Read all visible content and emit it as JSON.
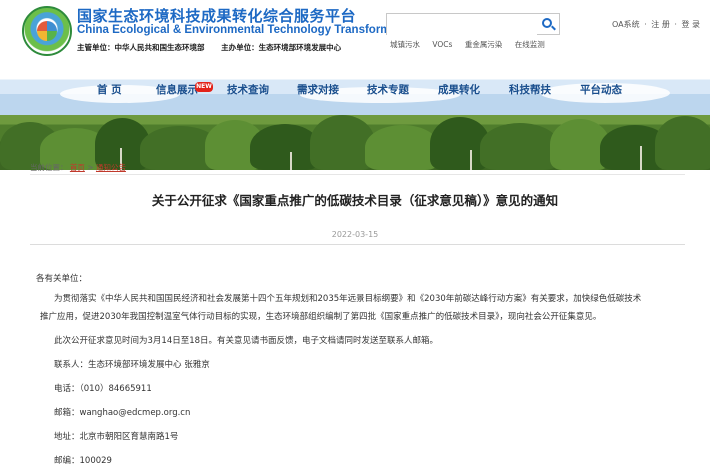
{
  "header": {
    "title_cn": "国家生态环境科技成果转化综合服务平台",
    "title_en": "China Ecological & Environmental Technology Transformation",
    "sponsor": "主管单位：中华人民共和国生态环境部",
    "organizer": "主办单位：生态环境部环境发展中心",
    "search_placeholder": "",
    "hot_tags": [
      "城镇污水",
      "VOCs",
      "重金属污染",
      "在线监测"
    ],
    "top_links": {
      "oa": "OA系统",
      "sep": "·",
      "register": "注 册",
      "sep2": "·",
      "login": "登 录"
    }
  },
  "nav": {
    "items": [
      "首  页",
      "信息展示",
      "技术查询",
      "需求对接",
      "技术专题",
      "成果转化",
      "科技帮扶",
      "平台动态"
    ],
    "badge": "NEW"
  },
  "breadcrumb": {
    "prefix": "当前位置：",
    "home": "首页",
    "sep": ">",
    "current": "通知公告"
  },
  "article": {
    "title": "关于公开征求《国家重点推广的低碳技术目录（征求意见稿）》意见的通知",
    "date": "2022-03-15",
    "greeting": "各有关单位：",
    "para1_line1": "为贯彻落实《中华人民共和国国民经济和社会发展第十四个五年规划和2035年远景目标纲要》和《2030年前碳达峰行动方案》有关要求，加快绿色低碳技术",
    "para1_line2": "推广应用，促进2030年我国控制温室气体行动目标的实现，生态环境部组织编制了第四批《国家重点推广的低碳技术目录》，现向社会公开征集意见。",
    "para2": "此次公开征求意见时间为3月14日至18日。有关意见请书面反馈，电子文档请同时发送至联系人邮箱。",
    "contact": "联系人：生态环境部环境发展中心 张雅京",
    "phone": "电话：（010）84665911",
    "email": "邮箱：wanghao@edcmep.org.cn",
    "address": "地址：北京市朝阳区育慧南路1号",
    "postcode": "邮编：100029"
  }
}
